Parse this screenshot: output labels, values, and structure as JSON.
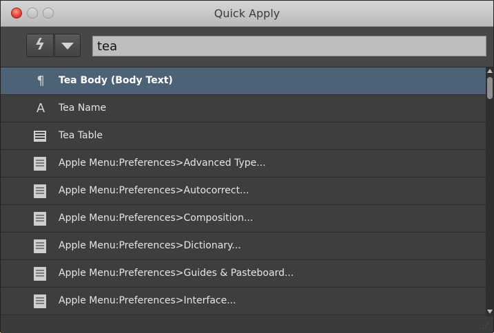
{
  "window": {
    "title": "Quick Apply"
  },
  "search": {
    "value": "tea",
    "bolt_glyph": "ϟ"
  },
  "icons": {
    "paragraph": "¶",
    "character": "A"
  },
  "colors": {
    "selected_row": "#4d6177",
    "background": "#3e3e3e",
    "close_button": "#e0443b"
  },
  "items": [
    {
      "label": "Tea Body (Body Text)",
      "icon": "paragraph-style-icon",
      "selected": true
    },
    {
      "label": "Tea Name",
      "icon": "character-style-icon",
      "selected": false
    },
    {
      "label": "Tea Table",
      "icon": "table-style-icon",
      "selected": false
    },
    {
      "label": "Apple Menu:Preferences>Advanced Type...",
      "icon": "menu-command-icon",
      "selected": false
    },
    {
      "label": "Apple Menu:Preferences>Autocorrect...",
      "icon": "menu-command-icon",
      "selected": false
    },
    {
      "label": "Apple Menu:Preferences>Composition...",
      "icon": "menu-command-icon",
      "selected": false
    },
    {
      "label": "Apple Menu:Preferences>Dictionary...",
      "icon": "menu-command-icon",
      "selected": false
    },
    {
      "label": "Apple Menu:Preferences>Guides & Pasteboard...",
      "icon": "menu-command-icon",
      "selected": false
    },
    {
      "label": "Apple Menu:Preferences>Interface...",
      "icon": "menu-command-icon",
      "selected": false
    }
  ]
}
